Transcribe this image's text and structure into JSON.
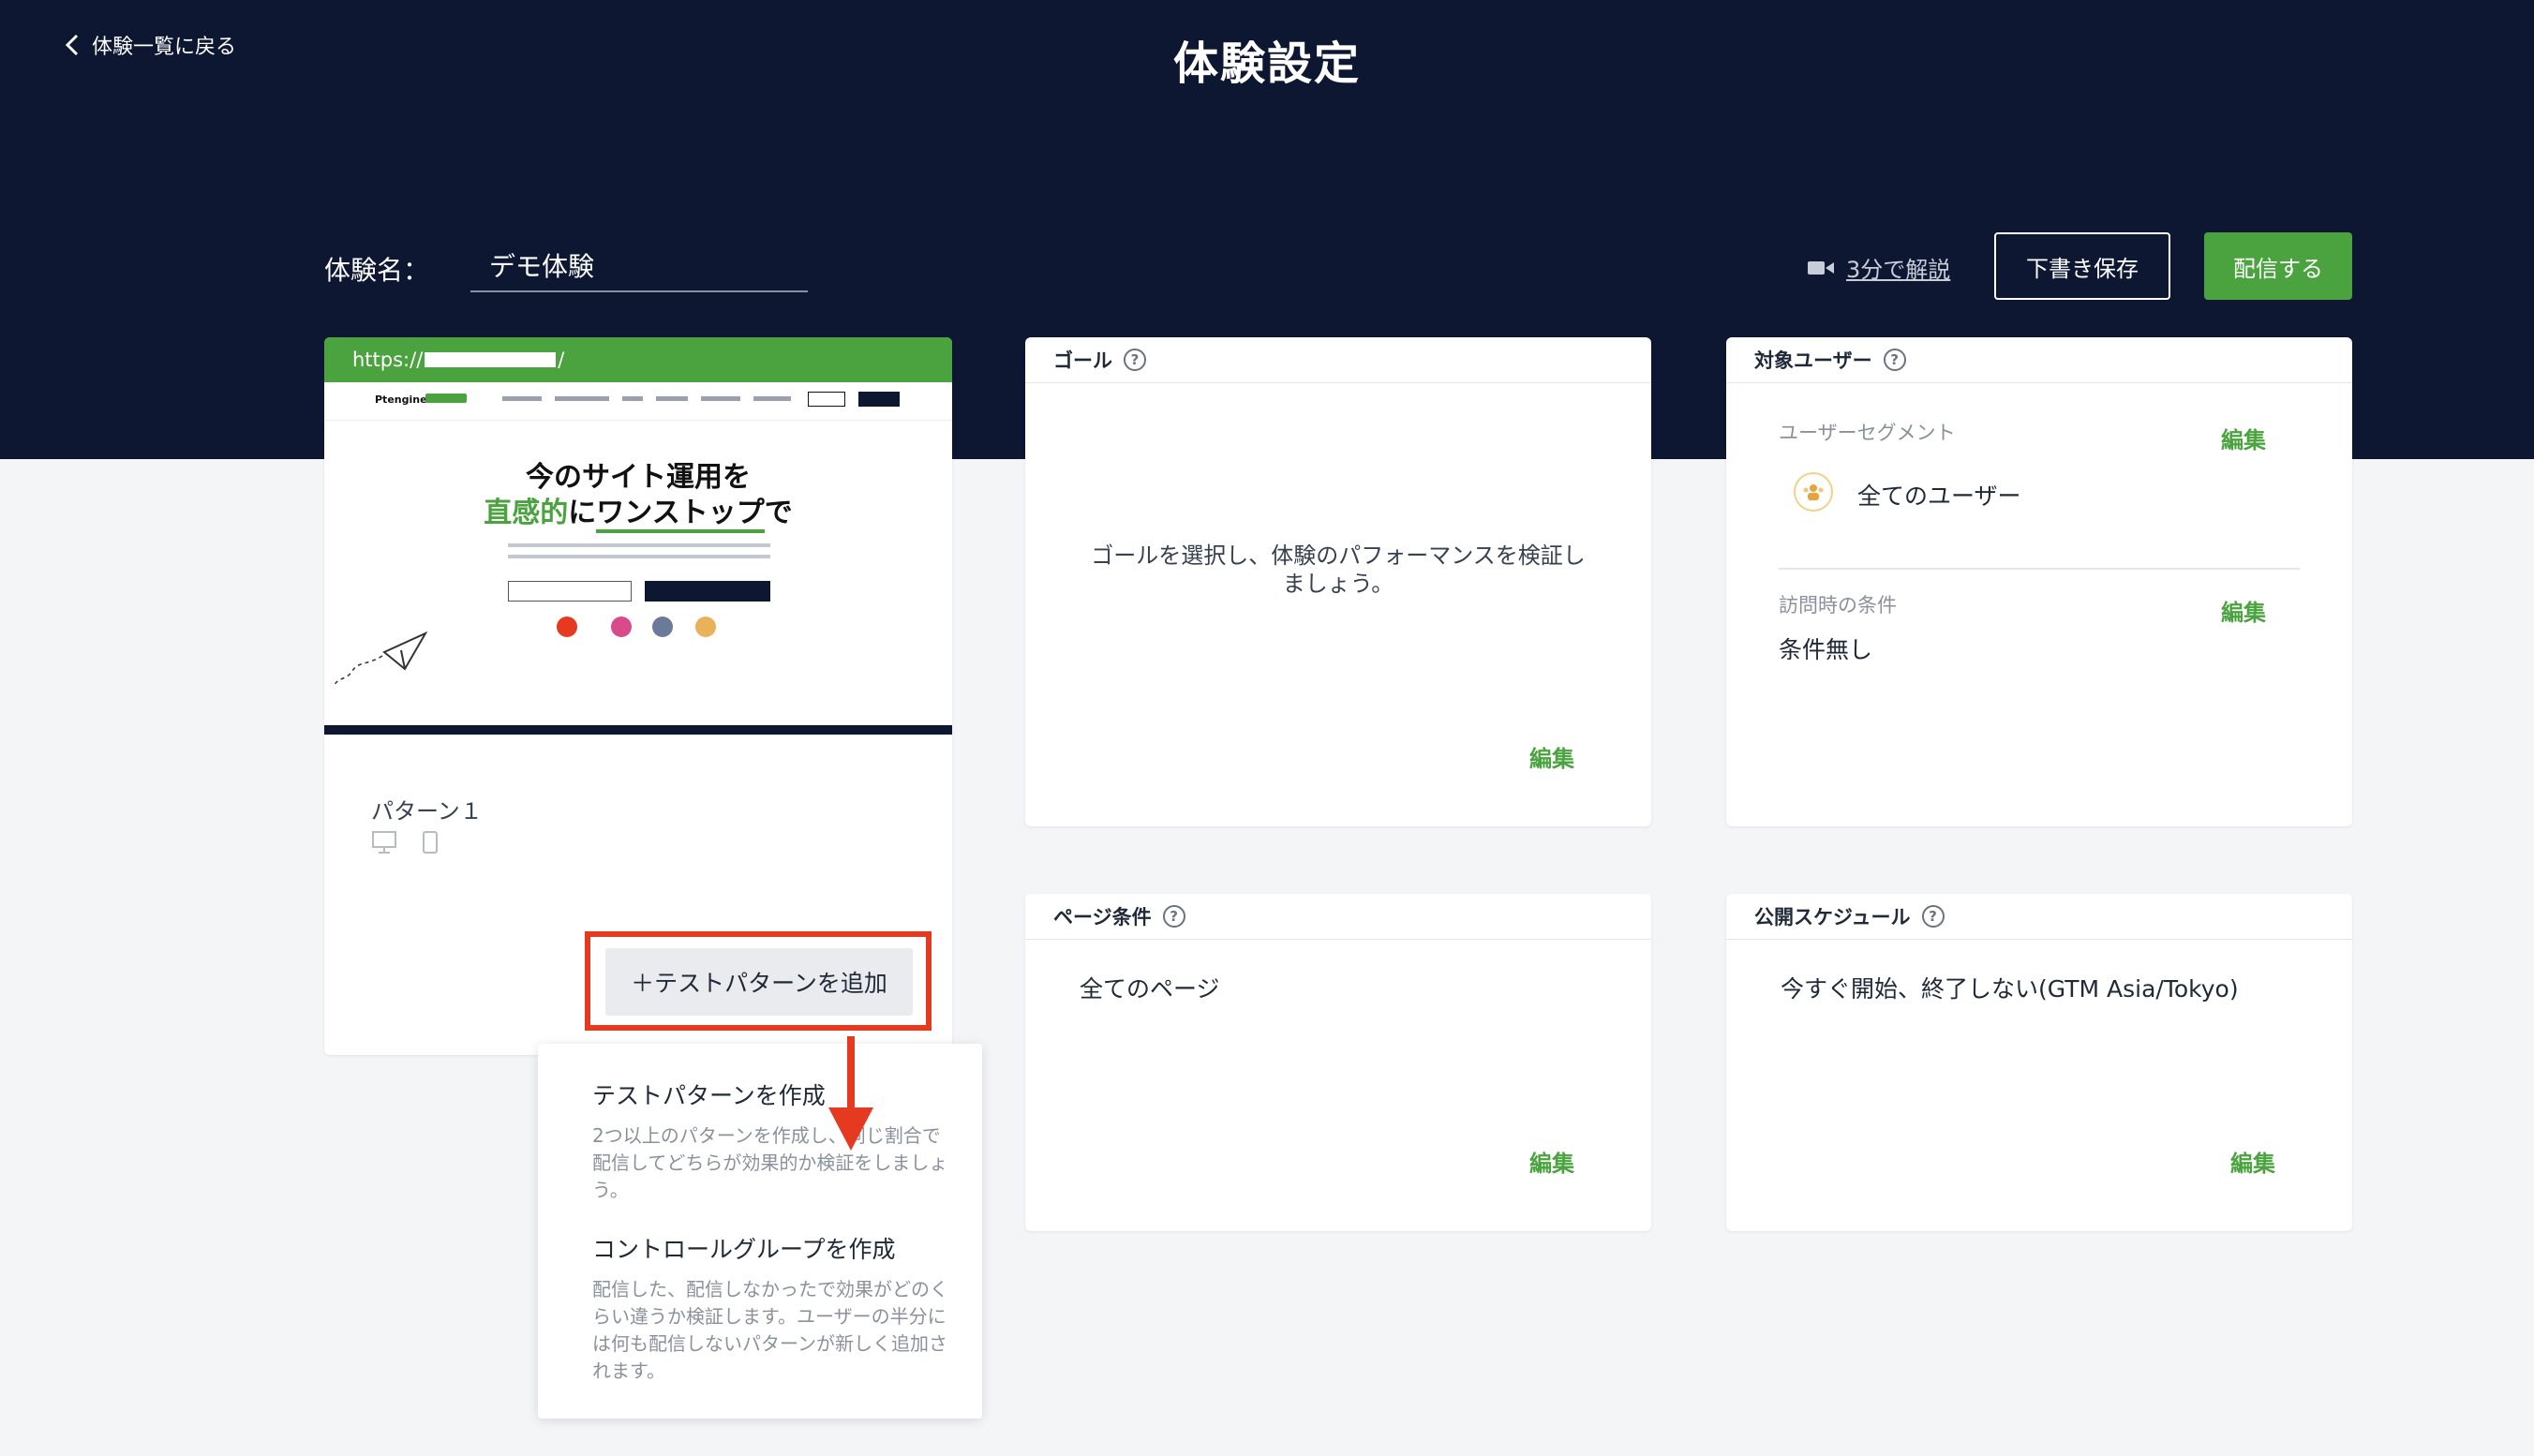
{
  "header": {
    "back_label": "体験一覧に戻る",
    "title": "体験設定"
  },
  "experience": {
    "name_label": "体験名：",
    "name_value": "デモ体験"
  },
  "actions": {
    "video_label": "3分で解説",
    "draft_label": "下書き保存",
    "publish_label": "配信する"
  },
  "preview": {
    "url_prefix": "https://",
    "url_suffix": "/",
    "hero_line1": "今のサイト運用を",
    "hero_line2_green": "直感的",
    "hero_line2_mid": "に",
    "hero_line2_underline": "ワンストップ",
    "hero_line2_end": "で",
    "pattern_name": "パターン１"
  },
  "add_pattern": {
    "label": "＋テストパターンを追加"
  },
  "popup": {
    "items": [
      {
        "title": "テストパターンを作成",
        "desc": "2つ以上のパターンを作成し、同じ割合で配信してどちらが効果的か検証をしましょう。"
      },
      {
        "title": "コントロールグループを作成",
        "desc": "配信した、配信しなかったで効果がどのくらい違うか検証します。ユーザーの半分には何も配信しないパターンが新しく追加されます。"
      }
    ]
  },
  "goal": {
    "title": "ゴール",
    "text": "ゴールを選択し、体験のパフォーマンスを検証しましょう。",
    "edit": "編集"
  },
  "target": {
    "title": "対象ユーザー",
    "segment_label": "ユーザーセグメント",
    "segment_value": "全てのユーザー",
    "visit_label": "訪問時の条件",
    "visit_value": "条件無し",
    "edit": "編集"
  },
  "page_condition": {
    "title": "ページ条件",
    "value": "全てのページ",
    "edit": "編集"
  },
  "schedule": {
    "title": "公開スケジュール",
    "value": "今すぐ開始、終了しない(GTM Asia/Tokyo)",
    "edit": "編集"
  },
  "colors": {
    "header_bg": "#0d1732",
    "accent_green": "#4aa33f",
    "highlight_red": "#e53a1f"
  },
  "icons": [
    "chevron-left-icon",
    "video-icon",
    "help-icon",
    "desktop-icon",
    "mobile-icon",
    "users-icon",
    "arrow-down-icon"
  ]
}
